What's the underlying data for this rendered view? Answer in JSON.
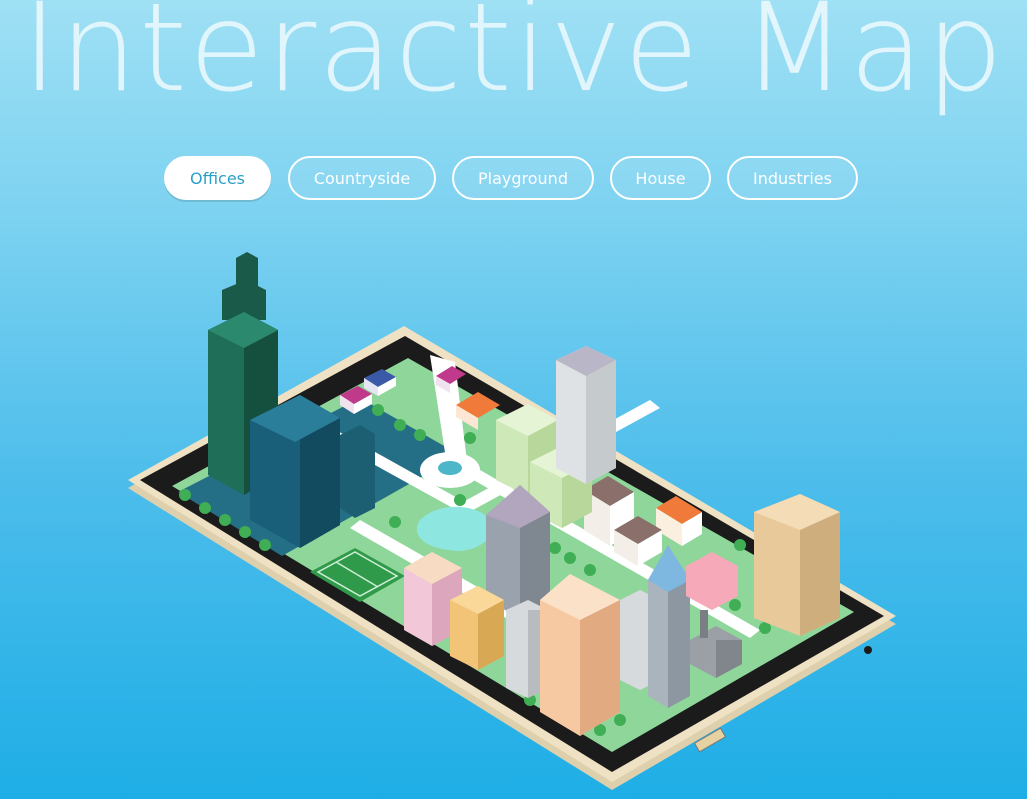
{
  "header": {
    "title": "Interactive Map"
  },
  "filters": {
    "active": "Offices",
    "items": [
      {
        "label": "Offices"
      },
      {
        "label": "Countryside"
      },
      {
        "label": "Playground"
      },
      {
        "label": "House"
      },
      {
        "label": "Industries"
      }
    ]
  },
  "map": {
    "icons": [
      "smartphone-icon",
      "skyscraper-icon",
      "tree-icon",
      "house-icon",
      "fountain-icon",
      "soccer-field-icon",
      "pond-icon",
      "factory-icon"
    ]
  },
  "colors": {
    "background_top": "#9fe0f4",
    "background_bottom": "#1eaee6",
    "accent_text": "#2a9fc8",
    "phone_body": "#efe2c4",
    "screen_dark": "#1b1b1b",
    "grass": "#7fcf8a",
    "road": "#ffffff"
  }
}
